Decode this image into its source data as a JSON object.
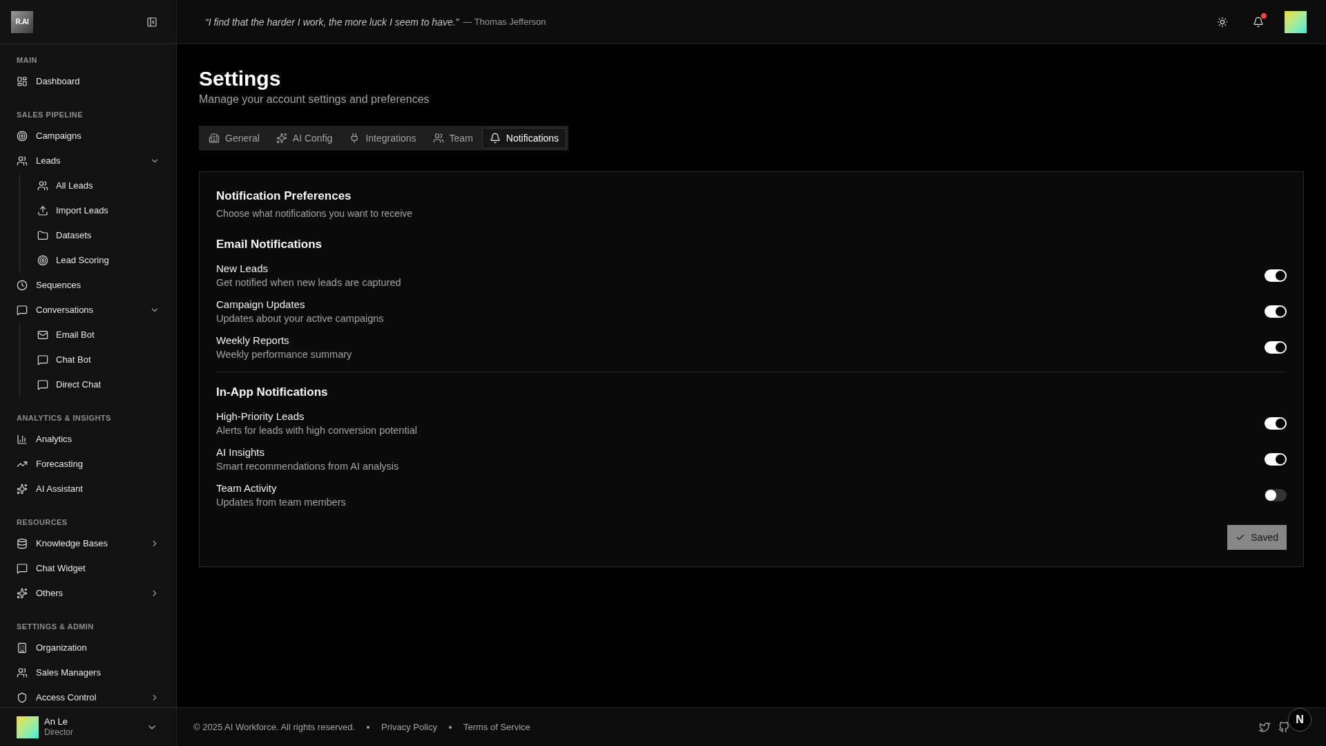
{
  "sidebar": {
    "logo": {
      "text": "R.AI"
    },
    "sections": [
      {
        "label": "MAIN",
        "items": [
          {
            "label": "Dashboard",
            "kind": "link"
          }
        ]
      },
      {
        "label": "SALES PIPELINE",
        "items": [
          {
            "label": "Campaigns",
            "kind": "link"
          },
          {
            "label": "Leads",
            "kind": "group",
            "expanded": true,
            "children": [
              {
                "label": "All Leads"
              },
              {
                "label": "Import Leads"
              },
              {
                "label": "Datasets"
              },
              {
                "label": "Lead Scoring"
              }
            ]
          },
          {
            "label": "Sequences",
            "kind": "link"
          },
          {
            "label": "Conversations",
            "kind": "group",
            "expanded": true,
            "children": [
              {
                "label": "Email Bot"
              },
              {
                "label": "Chat Bot"
              },
              {
                "label": "Direct Chat"
              }
            ]
          }
        ]
      },
      {
        "label": "ANALYTICS & INSIGHTS",
        "items": [
          {
            "label": "Analytics",
            "kind": "link"
          },
          {
            "label": "Forecasting",
            "kind": "link"
          },
          {
            "label": "AI Assistant",
            "kind": "link"
          }
        ]
      },
      {
        "label": "RESOURCES",
        "items": [
          {
            "label": "Knowledge Bases",
            "kind": "group",
            "expanded": false
          },
          {
            "label": "Chat Widget",
            "kind": "link"
          },
          {
            "label": "Others",
            "kind": "group",
            "expanded": false
          }
        ]
      },
      {
        "label": "SETTINGS & ADMIN",
        "items": [
          {
            "label": "Organization",
            "kind": "link"
          },
          {
            "label": "Sales Managers",
            "kind": "link"
          },
          {
            "label": "Access Control",
            "kind": "group",
            "expanded": false
          }
        ]
      }
    ],
    "user": {
      "name": "An Le",
      "role": "Director"
    }
  },
  "header": {
    "quote": "“I find that the harder I work, the more luck I seem to have.”",
    "author": "— Thomas Jefferson",
    "notifications": {
      "unread": true
    }
  },
  "page": {
    "title": "Settings",
    "subtitle": "Manage your account settings and preferences"
  },
  "tabs": [
    {
      "label": "General",
      "selected": false
    },
    {
      "label": "AI Config",
      "selected": false
    },
    {
      "label": "Integrations",
      "selected": false
    },
    {
      "label": "Team",
      "selected": false
    },
    {
      "label": "Notifications",
      "selected": true
    }
  ],
  "card": {
    "title": "Notification Preferences",
    "subtitle": "Choose what notifications you want to receive",
    "groups": [
      {
        "heading": "Email Notifications",
        "options": [
          {
            "label": "New Leads",
            "description": "Get notified when new leads are captured",
            "on": true
          },
          {
            "label": "Campaign Updates",
            "description": "Updates about your active campaigns",
            "on": true
          },
          {
            "label": "Weekly Reports",
            "description": "Weekly performance summary",
            "on": true
          }
        ]
      },
      {
        "heading": "In-App Notifications",
        "options": [
          {
            "label": "High-Priority Leads",
            "description": "Alerts for leads with high conversion potential",
            "on": true
          },
          {
            "label": "AI Insights",
            "description": "Smart recommendations from AI analysis",
            "on": true
          },
          {
            "label": "Team Activity",
            "description": "Updates from team members",
            "on": false
          }
        ]
      }
    ],
    "save_button": {
      "label": "Saved",
      "disabled": true
    }
  },
  "footer": {
    "copyright": "© 2025 AI Workforce. All rights reserved.",
    "links": [
      "Privacy Policy",
      "Terms of Service"
    ]
  },
  "dev_badge": {
    "label": "N"
  }
}
